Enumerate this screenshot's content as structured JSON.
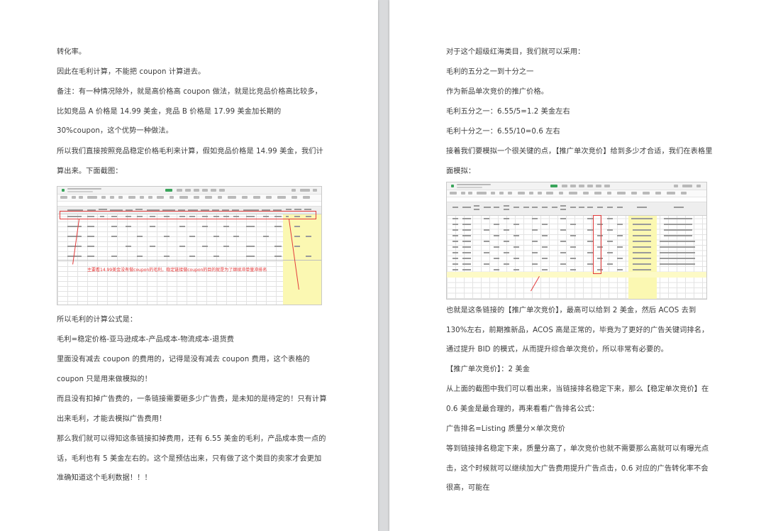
{
  "left_page": {
    "paragraphs": [
      "转化率。",
      "因此在毛利计算，不能把 coupon 计算进去。",
      "备注：有一种情况除外，就是高价格高 coupon 做法，就是比竞品价格高比较多，比如竞品 A 价格是 14.99 美金，竞品 B 价格是 17.99 美金加长期的 30%coupon，这个优势一种做法。",
      "所以我们直接按照竞品稳定价格毛利来计算，假如竞品价格是 14.99 美金，我们计算出来。下面截图：",
      "所以毛利的计算公式是：",
      "毛利=稳定价格-亚马逊成本-产品成本-物流成本-退货费",
      "里面没有减去 coupon 的费用的，记得是没有减去 coupon 费用，这个表格的 coupon 只是用来做模拟的！",
      "而且没有扣掉广告费的，一条链接需要砸多少广告费，是未知的是待定的！只有计算出来毛利，才能去模拟广告费用！",
      "那么我们就可以得知这条链接扣掉费用，还有 6.55 美金的毛利，产品成本贵一点的话，毛利也有 5 美金左右的。这个是预估出来，只有做了这个类目的卖家才会更加准确知道这个毛利数据！！！"
    ],
    "screenshot": {
      "annotation": "主要看14.99美金没有做coupon的毛利，稳定链接做coupon的目的就是为了继续冲单量冲排名"
    }
  },
  "right_page": {
    "paragraphs": [
      "对于这个超级红海类目，我们就可以采用：",
      "毛利的五分之一到十分之一",
      "作为新品单次竞价的推广价格。",
      "毛利五分之一：6.55/5=1.2 美金左右",
      "毛利十分之一：6.55/10=0.6 左右",
      "接着我们要模拟一个很关键的点，【推广单次竞价】给到多少才合适，我们在表格里面模拟：",
      "也就是这条链接的【推广单次竞价】，最高可以给到 2 美金，然后 ACOS 去到 130%左右，前期推新品，ACOS 高是正常的，毕竟为了更好的广告关键词排名，通过提升 BID 的模式，从而提升综合单次竞价，所以非常有必要的。",
      "【推广单次竞价】：2 美金",
      "从上面的截图中我们可以看出来，当链接排名稳定下来，那么【稳定单次竞价】在 0.6 美金是最合理的，再来看看广告排名公式：",
      "广告排名=Listing 质量分×单次竞价",
      "等到链接排名稳定下来，质量分高了，单次竞价也就不需要那么高就可以有曝光点击，这个时候就可以继续加大广告费用提升广告点击，0.6 对应的广告转化率不会很高，可能在"
    ]
  }
}
